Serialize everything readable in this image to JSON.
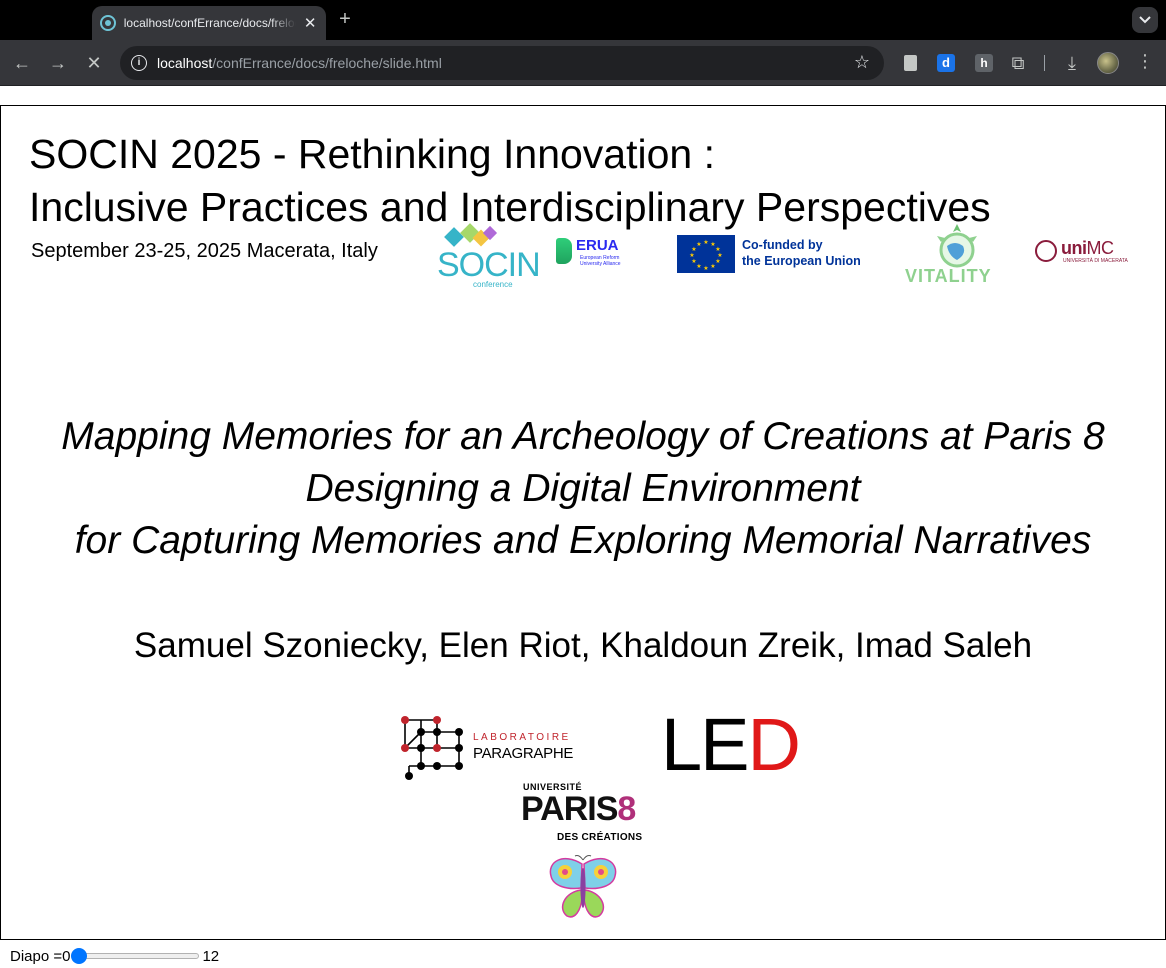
{
  "browser": {
    "tab_title": "localhost/confErrance/docs/freloche/slide.html",
    "tab_close": "✕",
    "new_tab": "+",
    "url_host": "localhost",
    "url_path": "/confErrance/docs/freloche/slide.html"
  },
  "slide": {
    "conference_title_line1": "SOCIN 2025 - Rethinking Innovation :",
    "conference_title_line2": "Inclusive Practices and Interdisciplinary Perspectives",
    "conference_date": "September 23-25, 2025 Macerata, Italy",
    "logos": {
      "socin_word": "SOCIN",
      "socin_sub": "conference",
      "erua_word": "ERUA",
      "erua_sub": "European Reform University Alliance",
      "eu_line1": "Co-funded by",
      "eu_line2": "the European Union",
      "vitality_word": "VITALITY",
      "unimc_bold": "uni",
      "unimc_rest": "MC",
      "unimc_sub": "UNIVERSITÀ DI MACERATA",
      "paragraphe_line1": "LABORATOIRE",
      "paragraphe_line2": "PARAGRAPHE",
      "led_black": "LE",
      "led_red": "D",
      "paris8_univ": "UNIVERSITÉ",
      "paris8_main": "PARIS",
      "paris8_eight": "8",
      "paris8_sub": "DES CRÉATIONS"
    },
    "talk_title_line1": "Mapping Memories for an Archeology of Creations at Paris 8",
    "talk_title_line2": "Designing a Digital Environment",
    "talk_title_line3": "for Capturing Memories and Exploring Memorial Narratives",
    "authors": "Samuel Szoniecky, Elen Riot, Khaldoun Zreik, Imad Saleh"
  },
  "footer": {
    "label": "Diapo = ",
    "current_value": "0",
    "max_value": "12",
    "slider_fraction": 0
  },
  "colors": {
    "slider_accent": "#0075ff",
    "eu_blue": "#003399",
    "socin_teal": "#36b4c8",
    "unimc_red": "#8a1c3c",
    "led_red": "#e01818"
  }
}
